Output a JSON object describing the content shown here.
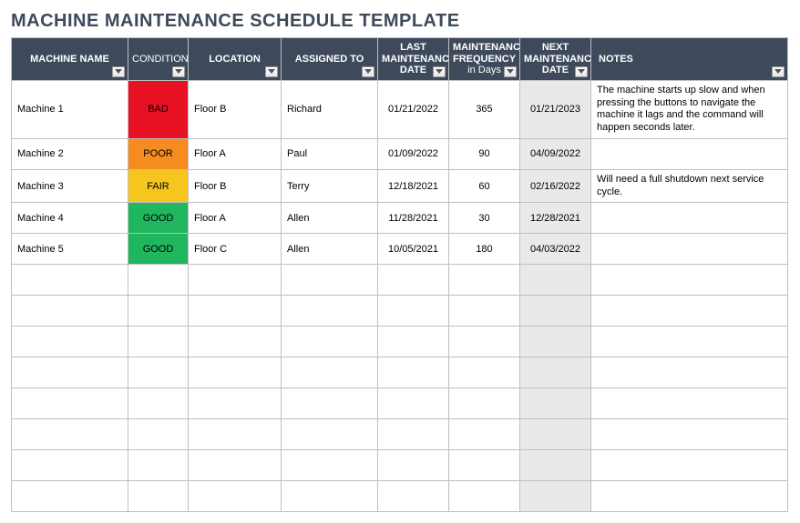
{
  "title": "MACHINE MAINTENANCE SCHEDULE TEMPLATE",
  "columns": {
    "name": {
      "line1": "MACHINE NAME",
      "line2": ""
    },
    "condition": {
      "line1": "CONDITION",
      "line2": ""
    },
    "location": {
      "line1": "LOCATION",
      "line2": ""
    },
    "assigned": {
      "line1": "ASSIGNED TO",
      "line2": ""
    },
    "last": {
      "line1": "LAST MAINTENANCE DATE",
      "line2": ""
    },
    "freq": {
      "line1": "MAINTENANCE FREQUENCY",
      "line2": "in Days"
    },
    "next": {
      "line1": "NEXT MAINTENANCE DATE",
      "line2": ""
    },
    "notes": {
      "line1": "NOTES",
      "line2": ""
    }
  },
  "condition_colors": {
    "BAD": "#e81123",
    "POOR": "#f68b1f",
    "FAIR": "#f6c61f",
    "GOOD": "#1fb65d"
  },
  "rows": [
    {
      "name": "Machine 1",
      "condition": "BAD",
      "location": "Floor B",
      "assigned": "Richard",
      "last": "01/21/2022",
      "freq": "365",
      "next": "01/21/2023",
      "notes": "The machine starts up slow and when pressing the buttons to navigate the machine it lags and the command will happen seconds later."
    },
    {
      "name": "Machine 2",
      "condition": "POOR",
      "location": "Floor A",
      "assigned": "Paul",
      "last": "01/09/2022",
      "freq": "90",
      "next": "04/09/2022",
      "notes": ""
    },
    {
      "name": "Machine 3",
      "condition": "FAIR",
      "location": "Floor B",
      "assigned": "Terry",
      "last": "12/18/2021",
      "freq": "60",
      "next": "02/16/2022",
      "notes": "Will need a full shutdown next service cycle."
    },
    {
      "name": "Machine 4",
      "condition": "GOOD",
      "location": "Floor A",
      "assigned": "Allen",
      "last": "11/28/2021",
      "freq": "30",
      "next": "12/28/2021",
      "notes": ""
    },
    {
      "name": "Machine 5",
      "condition": "GOOD",
      "location": "Floor C",
      "assigned": "Allen",
      "last": "10/05/2021",
      "freq": "180",
      "next": "04/03/2022",
      "notes": ""
    },
    {
      "name": "",
      "condition": "",
      "location": "",
      "assigned": "",
      "last": "",
      "freq": "",
      "next": "",
      "notes": ""
    },
    {
      "name": "",
      "condition": "",
      "location": "",
      "assigned": "",
      "last": "",
      "freq": "",
      "next": "",
      "notes": ""
    },
    {
      "name": "",
      "condition": "",
      "location": "",
      "assigned": "",
      "last": "",
      "freq": "",
      "next": "",
      "notes": ""
    },
    {
      "name": "",
      "condition": "",
      "location": "",
      "assigned": "",
      "last": "",
      "freq": "",
      "next": "",
      "notes": ""
    },
    {
      "name": "",
      "condition": "",
      "location": "",
      "assigned": "",
      "last": "",
      "freq": "",
      "next": "",
      "notes": ""
    },
    {
      "name": "",
      "condition": "",
      "location": "",
      "assigned": "",
      "last": "",
      "freq": "",
      "next": "",
      "notes": ""
    },
    {
      "name": "",
      "condition": "",
      "location": "",
      "assigned": "",
      "last": "",
      "freq": "",
      "next": "",
      "notes": ""
    },
    {
      "name": "",
      "condition": "",
      "location": "",
      "assigned": "",
      "last": "",
      "freq": "",
      "next": "",
      "notes": ""
    }
  ]
}
